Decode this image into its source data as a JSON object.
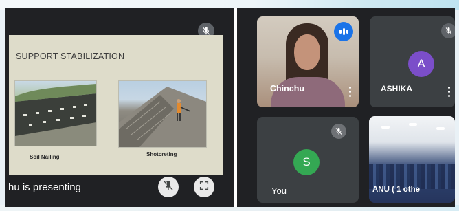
{
  "presentation": {
    "slide_title": "SUPPORT STABILIZATION",
    "photo_left_caption": "Soil Nailing",
    "photo_right_caption": "Shotcreting",
    "presenting_text": "hu is presenting",
    "pin_icon": "pin-off-icon",
    "fullscreen_icon": "fullscreen-icon",
    "mic_icon": "mic-off-icon"
  },
  "participants": [
    {
      "name": "Chinchu",
      "speaking_icon": "speaking-icon",
      "menu_icon": "more-vert-icon"
    },
    {
      "name": "ASHIKA",
      "initial": "A",
      "avatar_color": "#7b4ec9",
      "mic_icon": "mic-off-icon",
      "menu_icon": "more-vert-icon"
    },
    {
      "name": "You",
      "initial": "S",
      "avatar_color": "#34a853",
      "mic_icon": "mic-off-icon"
    },
    {
      "name": "ANU ( 1 othe"
    }
  ],
  "colors": {
    "background": "#202124",
    "tile": "#3c4043",
    "accent_blue": "#1a73e8"
  }
}
